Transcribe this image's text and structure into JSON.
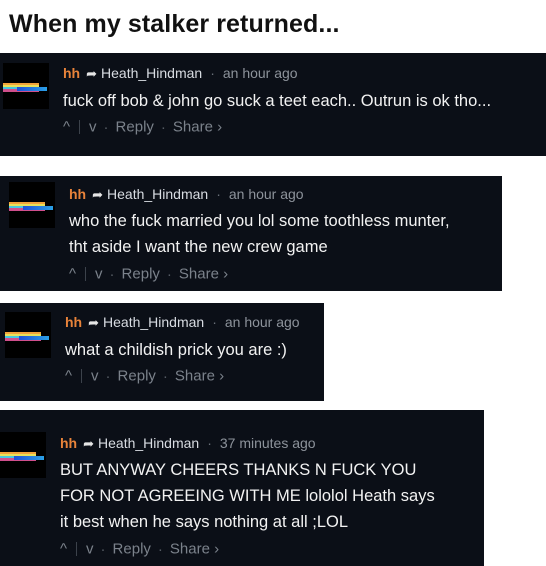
{
  "title": "When my stalker returned...",
  "comments": [
    {
      "user": "hh",
      "reply_to": "Heath_Hindman",
      "time": "an hour ago",
      "lines": [
        "fuck off bob & john go suck a teet each.. Outrun is ok tho..."
      ],
      "upvote": "^",
      "downvote": "v",
      "reply": "Reply",
      "share": "Share ›"
    },
    {
      "user": "hh",
      "reply_to": "Heath_Hindman",
      "time": "an hour ago",
      "lines": [
        "who the fuck married you lol some toothless munter,",
        "tht aside I want the new crew game"
      ],
      "upvote": "^",
      "downvote": "v",
      "reply": "Reply",
      "share": "Share ›"
    },
    {
      "user": "hh",
      "reply_to": "Heath_Hindman",
      "time": "an hour ago",
      "lines": [
        "what a childish prick you are :)"
      ],
      "upvote": "^",
      "downvote": "v",
      "reply": "Reply",
      "share": "Share ›"
    },
    {
      "user": "hh",
      "reply_to": "Heath_Hindman",
      "time": "37 minutes ago",
      "lines": [
        "BUT ANYWAY CHEERS THANKS N FUCK YOU",
        "FOR NOT AGREEING WITH ME lololol Heath says",
        "it best when he says nothing at all ;LOL"
      ],
      "upvote": "^",
      "downvote": "v",
      "reply": "Reply",
      "share": "Share ›"
    }
  ]
}
